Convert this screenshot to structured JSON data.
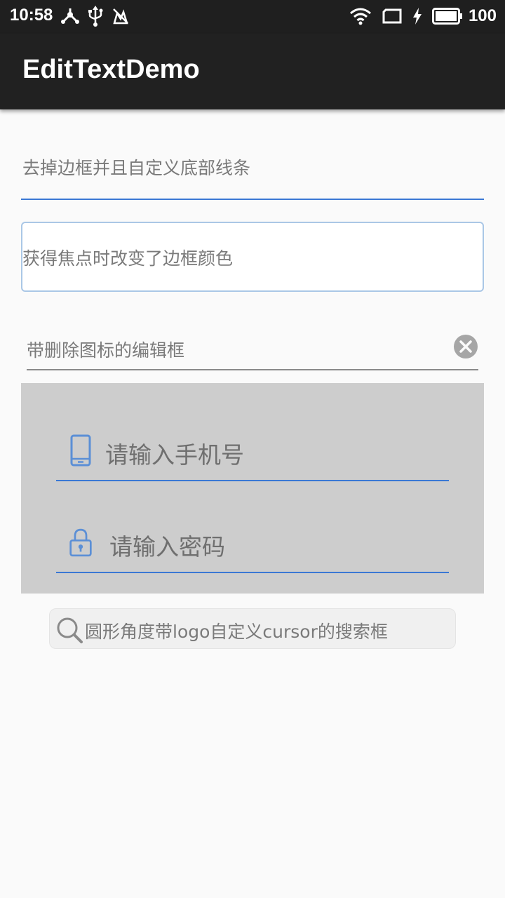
{
  "status_bar": {
    "time": "10:58",
    "battery": "100",
    "left_icons": [
      "share-icon",
      "usb-icon",
      "sync-off-icon"
    ],
    "right_icons": [
      "wifi-icon",
      "screen-icon",
      "charging-icon",
      "battery-icon"
    ]
  },
  "app_bar": {
    "title": "EditTextDemo"
  },
  "fields": {
    "bottom_line_hint": "去掉边框并且自定义底部线条",
    "focus_border_hint": "获得焦点时改变了边框颜色",
    "clearable_hint": "带删除图标的编辑框"
  },
  "login": {
    "phone_hint": "请输入手机号",
    "password_hint": "请输入密码"
  },
  "search": {
    "hint": "圆形角度带logo自定义cursor的搜索框"
  },
  "colors": {
    "accent": "#3a78d4",
    "icon_blue": "#5b8fd6",
    "focus_border": "#aac7e6",
    "app_bar": "#212121",
    "panel": "#cdcdcd"
  }
}
